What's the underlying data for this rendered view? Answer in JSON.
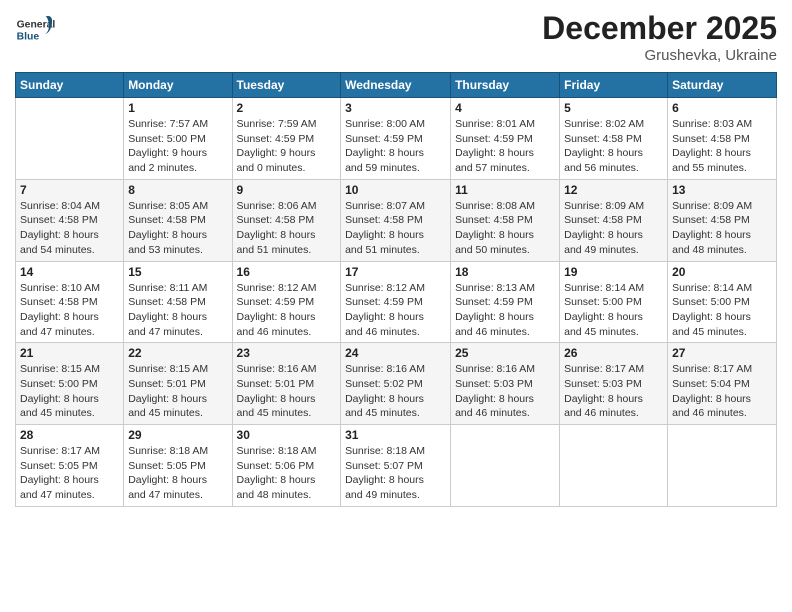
{
  "logo": {
    "general": "General",
    "blue": "Blue"
  },
  "header": {
    "month": "December 2025",
    "location": "Grushevka, Ukraine"
  },
  "weekdays": [
    "Sunday",
    "Monday",
    "Tuesday",
    "Wednesday",
    "Thursday",
    "Friday",
    "Saturday"
  ],
  "weeks": [
    [
      {
        "day": "",
        "info": ""
      },
      {
        "day": "1",
        "info": "Sunrise: 7:57 AM\nSunset: 5:00 PM\nDaylight: 9 hours\nand 2 minutes."
      },
      {
        "day": "2",
        "info": "Sunrise: 7:59 AM\nSunset: 4:59 PM\nDaylight: 9 hours\nand 0 minutes."
      },
      {
        "day": "3",
        "info": "Sunrise: 8:00 AM\nSunset: 4:59 PM\nDaylight: 8 hours\nand 59 minutes."
      },
      {
        "day": "4",
        "info": "Sunrise: 8:01 AM\nSunset: 4:59 PM\nDaylight: 8 hours\nand 57 minutes."
      },
      {
        "day": "5",
        "info": "Sunrise: 8:02 AM\nSunset: 4:58 PM\nDaylight: 8 hours\nand 56 minutes."
      },
      {
        "day": "6",
        "info": "Sunrise: 8:03 AM\nSunset: 4:58 PM\nDaylight: 8 hours\nand 55 minutes."
      }
    ],
    [
      {
        "day": "7",
        "info": "Sunrise: 8:04 AM\nSunset: 4:58 PM\nDaylight: 8 hours\nand 54 minutes."
      },
      {
        "day": "8",
        "info": "Sunrise: 8:05 AM\nSunset: 4:58 PM\nDaylight: 8 hours\nand 53 minutes."
      },
      {
        "day": "9",
        "info": "Sunrise: 8:06 AM\nSunset: 4:58 PM\nDaylight: 8 hours\nand 51 minutes."
      },
      {
        "day": "10",
        "info": "Sunrise: 8:07 AM\nSunset: 4:58 PM\nDaylight: 8 hours\nand 51 minutes."
      },
      {
        "day": "11",
        "info": "Sunrise: 8:08 AM\nSunset: 4:58 PM\nDaylight: 8 hours\nand 50 minutes."
      },
      {
        "day": "12",
        "info": "Sunrise: 8:09 AM\nSunset: 4:58 PM\nDaylight: 8 hours\nand 49 minutes."
      },
      {
        "day": "13",
        "info": "Sunrise: 8:09 AM\nSunset: 4:58 PM\nDaylight: 8 hours\nand 48 minutes."
      }
    ],
    [
      {
        "day": "14",
        "info": "Sunrise: 8:10 AM\nSunset: 4:58 PM\nDaylight: 8 hours\nand 47 minutes."
      },
      {
        "day": "15",
        "info": "Sunrise: 8:11 AM\nSunset: 4:58 PM\nDaylight: 8 hours\nand 47 minutes."
      },
      {
        "day": "16",
        "info": "Sunrise: 8:12 AM\nSunset: 4:59 PM\nDaylight: 8 hours\nand 46 minutes."
      },
      {
        "day": "17",
        "info": "Sunrise: 8:12 AM\nSunset: 4:59 PM\nDaylight: 8 hours\nand 46 minutes."
      },
      {
        "day": "18",
        "info": "Sunrise: 8:13 AM\nSunset: 4:59 PM\nDaylight: 8 hours\nand 46 minutes."
      },
      {
        "day": "19",
        "info": "Sunrise: 8:14 AM\nSunset: 5:00 PM\nDaylight: 8 hours\nand 45 minutes."
      },
      {
        "day": "20",
        "info": "Sunrise: 8:14 AM\nSunset: 5:00 PM\nDaylight: 8 hours\nand 45 minutes."
      }
    ],
    [
      {
        "day": "21",
        "info": "Sunrise: 8:15 AM\nSunset: 5:00 PM\nDaylight: 8 hours\nand 45 minutes."
      },
      {
        "day": "22",
        "info": "Sunrise: 8:15 AM\nSunset: 5:01 PM\nDaylight: 8 hours\nand 45 minutes."
      },
      {
        "day": "23",
        "info": "Sunrise: 8:16 AM\nSunset: 5:01 PM\nDaylight: 8 hours\nand 45 minutes."
      },
      {
        "day": "24",
        "info": "Sunrise: 8:16 AM\nSunset: 5:02 PM\nDaylight: 8 hours\nand 45 minutes."
      },
      {
        "day": "25",
        "info": "Sunrise: 8:16 AM\nSunset: 5:03 PM\nDaylight: 8 hours\nand 46 minutes."
      },
      {
        "day": "26",
        "info": "Sunrise: 8:17 AM\nSunset: 5:03 PM\nDaylight: 8 hours\nand 46 minutes."
      },
      {
        "day": "27",
        "info": "Sunrise: 8:17 AM\nSunset: 5:04 PM\nDaylight: 8 hours\nand 46 minutes."
      }
    ],
    [
      {
        "day": "28",
        "info": "Sunrise: 8:17 AM\nSunset: 5:05 PM\nDaylight: 8 hours\nand 47 minutes."
      },
      {
        "day": "29",
        "info": "Sunrise: 8:18 AM\nSunset: 5:05 PM\nDaylight: 8 hours\nand 47 minutes."
      },
      {
        "day": "30",
        "info": "Sunrise: 8:18 AM\nSunset: 5:06 PM\nDaylight: 8 hours\nand 48 minutes."
      },
      {
        "day": "31",
        "info": "Sunrise: 8:18 AM\nSunset: 5:07 PM\nDaylight: 8 hours\nand 49 minutes."
      },
      {
        "day": "",
        "info": ""
      },
      {
        "day": "",
        "info": ""
      },
      {
        "day": "",
        "info": ""
      }
    ]
  ]
}
